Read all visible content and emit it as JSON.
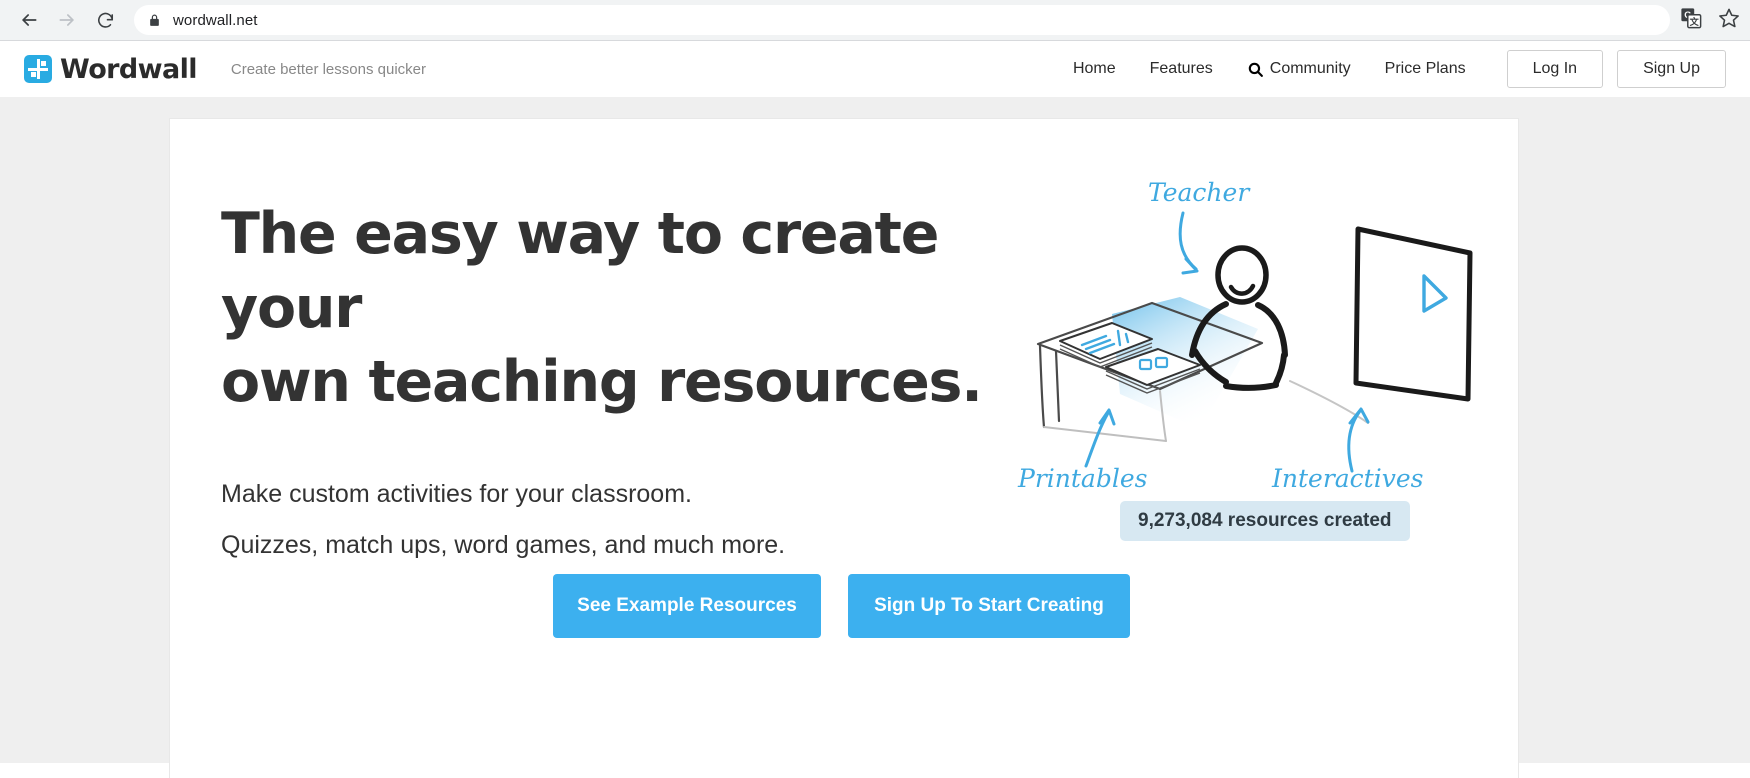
{
  "browser": {
    "back_icon": "back-arrow-icon",
    "forward_icon": "forward-arrow-icon",
    "reload_icon": "reload-icon",
    "lock_icon": "lock-icon",
    "url": "wordwall.net",
    "translate_icon": "google-translate-icon",
    "bookmark_icon": "star-icon"
  },
  "header": {
    "brand_name": "Wordwall",
    "brand_mark": "wordwall-logo-icon",
    "tagline": "Create better lessons quicker",
    "nav": [
      {
        "label": "Home",
        "icon": null
      },
      {
        "label": "Features",
        "icon": null
      },
      {
        "label": "Community",
        "icon": "search-icon"
      },
      {
        "label": "Price Plans",
        "icon": null
      }
    ],
    "login_label": "Log In",
    "signup_label": "Sign Up"
  },
  "hero": {
    "title_line1": "The easy way to create your",
    "title_line2": "own teaching resources.",
    "sub_line1": "Make custom activities for your classroom.",
    "sub_line2": "Quizzes, match ups, word games, and much more.",
    "badge": "9,273,084 resources created",
    "cta_primary": "See Example Resources",
    "cta_secondary": "Sign Up To Start Creating"
  },
  "illustration": {
    "name": "teacher-classroom-illustration",
    "label_teacher": "Teacher",
    "label_printables": "Printables",
    "label_interactives": "Interactives"
  },
  "colors": {
    "accent": "#3cb0ef",
    "brand": "#29ABE2",
    "badge_bg": "#d7e8f2",
    "page_bg": "#efefef",
    "chrome_bg": "#f1f3f4"
  }
}
